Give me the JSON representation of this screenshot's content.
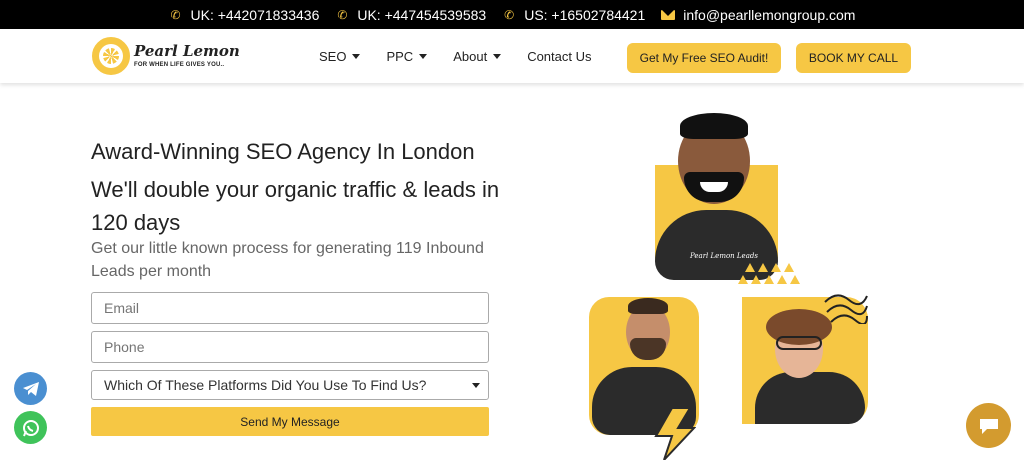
{
  "topbar": {
    "phones": [
      {
        "label": "UK: +442071833436",
        "icon": "phone-icon"
      },
      {
        "label": "UK: +447454539583",
        "icon": "phone-icon"
      },
      {
        "label": "US: +16502784421",
        "icon": "phone-icon"
      }
    ],
    "email": {
      "label": "info@pearllemongroup.com",
      "icon": "mail-icon"
    }
  },
  "brand": {
    "name": "Pearl Lemon",
    "tagline": "FOR WHEN LIFE GIVES YOU..",
    "color": "#f6c744"
  },
  "nav": {
    "items": [
      {
        "label": "SEO",
        "has_dropdown": true
      },
      {
        "label": "PPC",
        "has_dropdown": true
      },
      {
        "label": "About",
        "has_dropdown": true
      },
      {
        "label": "Contact Us",
        "has_dropdown": false
      }
    ],
    "cta_audit": "Get My Free SEO Audit!",
    "cta_call": "BOOK MY CALL"
  },
  "hero": {
    "title": "Award-Winning SEO Agency In London",
    "headline": "We'll double your organic traffic & leads in 120 days",
    "subtitle": "Get our little known process for generating 119 Inbound Leads per month"
  },
  "form": {
    "email_placeholder": "Email",
    "phone_placeholder": "Phone",
    "platform_select": "Which Of These Platforms Did You Use To Find Us?",
    "submit_label": "Send My Message"
  },
  "images": {
    "shirt_text": "Pearl Lemon Leads"
  },
  "floating": {
    "telegram_icon": "telegram-icon",
    "whatsapp_icon": "whatsapp-icon",
    "chat_icon": "chat-icon"
  }
}
